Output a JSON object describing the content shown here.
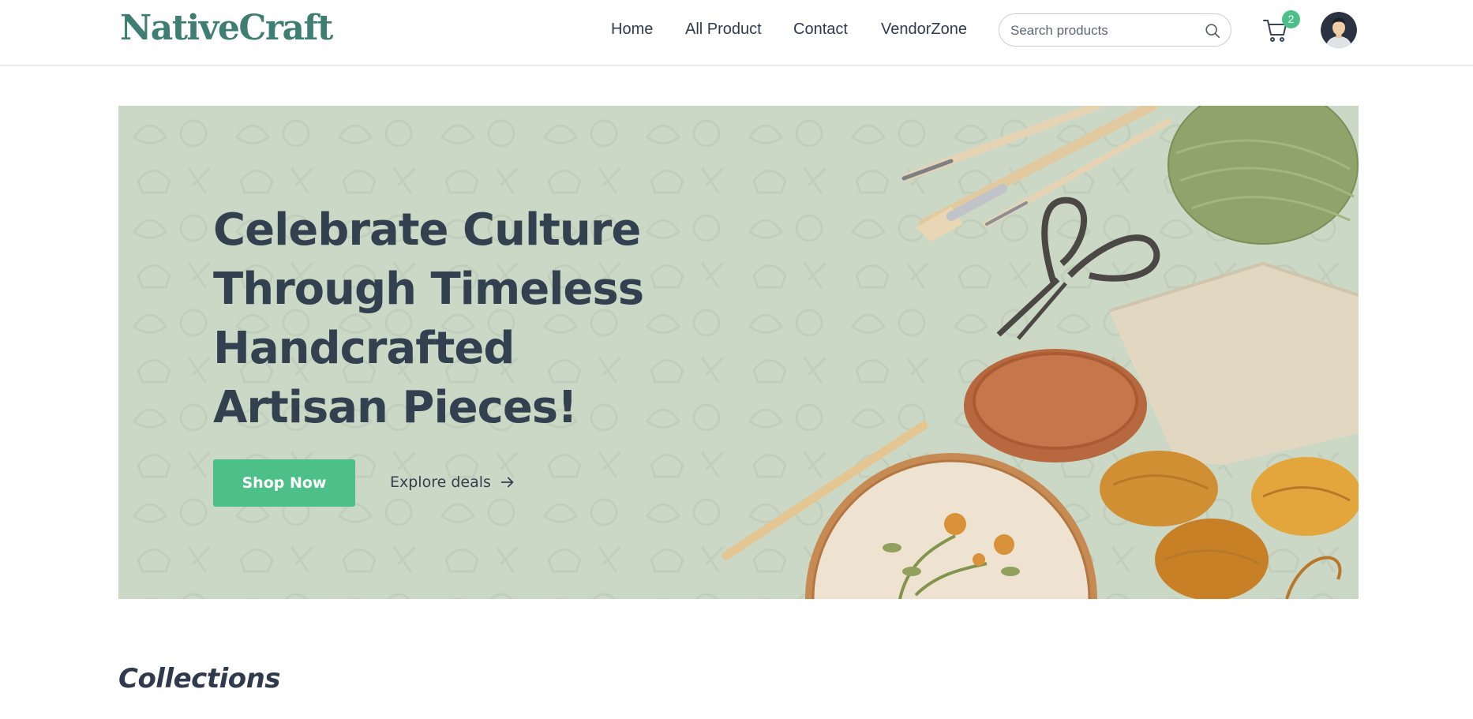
{
  "brand": {
    "logo_text": "NativeCraft",
    "logo_color": "#3f7f73"
  },
  "nav": {
    "items": [
      {
        "label": "Home"
      },
      {
        "label": "All Product"
      },
      {
        "label": "Contact"
      },
      {
        "label": "VendorZone"
      }
    ]
  },
  "search": {
    "placeholder": "Search products",
    "value": ""
  },
  "cart": {
    "count": "2",
    "icon": "cart-icon",
    "badge_color": "#4dbf88"
  },
  "user": {
    "avatar_icon": "user-avatar"
  },
  "hero": {
    "headline": "Celebrate Culture Through Timeless Handcrafted Artisan Pieces!",
    "primary_cta": "Shop Now",
    "secondary_cta": "Explore deals",
    "secondary_icon": "arrow-right-icon",
    "background_color": "#ccd8c6",
    "accent_color": "#4dbf88"
  },
  "sections": {
    "collections_title": "Collections"
  }
}
